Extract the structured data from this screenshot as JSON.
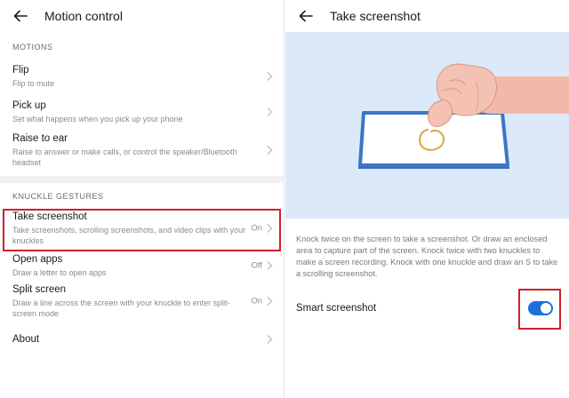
{
  "left": {
    "title": "Motion control",
    "sections": {
      "motions": "MOTIONS",
      "knuckle": "KNUCKLE GESTURES"
    },
    "items": {
      "flip": {
        "title": "Flip",
        "subtitle": "Flip to mute"
      },
      "pickup": {
        "title": "Pick up",
        "subtitle": "Set what happens when you pick up your phone"
      },
      "raise": {
        "title": "Raise to ear",
        "subtitle": "Raise to answer or make calls, or control the speaker/Bluetooth headset"
      },
      "take": {
        "title": "Take screenshot",
        "subtitle": "Take screenshots, scrolling screenshots, and video clips with your knuckles",
        "status": "On"
      },
      "open": {
        "title": "Open apps",
        "subtitle": "Draw a letter to open apps",
        "status": "Off"
      },
      "split": {
        "title": "Split screen",
        "subtitle": "Draw a line across the screen with your knuckle to enter split-screen mode",
        "status": "On"
      },
      "about": {
        "title": "About"
      }
    }
  },
  "right": {
    "title": "Take screenshot",
    "description": "Knock twice on the screen to take a screenshot. Or draw an enclosed area to capture part of the screen. Knock twice with two knuckles to make a screen recording. Knock with one knuckle and draw an S to take a scrolling screenshot.",
    "smart_label": "Smart screenshot",
    "smart_on": true
  },
  "colors": {
    "accent": "#1e6fdb",
    "highlight": "#d0202c",
    "illustration_bg": "#dbe9f8"
  },
  "icons": {
    "back": "back-arrow-icon",
    "chevron": "chevron-right-icon"
  }
}
